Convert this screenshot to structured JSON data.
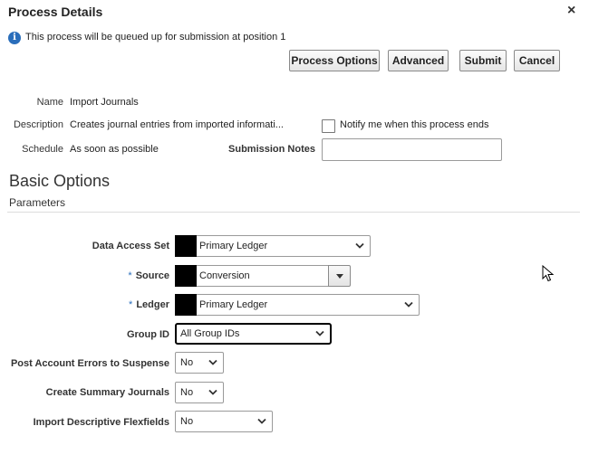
{
  "dialog": {
    "title": "Process Details",
    "close_glyph": "×",
    "info_message": "This process will be queued up for submission at position 1"
  },
  "toolbar": {
    "process_options": "Process Options",
    "advanced": "Advanced",
    "submit": "Submit",
    "cancel": "Cancel"
  },
  "details": {
    "name_label": "Name",
    "name_value": "Import Journals",
    "description_label": "Description",
    "description_value": "Creates journal entries from imported informati...",
    "schedule_label": "Schedule",
    "schedule_value": "As soon as possible",
    "notify_label": "Notify me when this process ends",
    "notify_checked": false,
    "submission_notes_label": "Submission Notes",
    "submission_notes_value": ""
  },
  "basic_options": {
    "heading": "Basic Options",
    "subheading": "Parameters"
  },
  "parameters": {
    "data_access_set": {
      "label": "Data Access Set",
      "value": "Primary Ledger"
    },
    "source": {
      "label": "Source",
      "value": "Conversion",
      "required_mark": "*"
    },
    "ledger": {
      "label": "Ledger",
      "value": "Primary Ledger",
      "required_mark": "*"
    },
    "group_id": {
      "label": "Group ID",
      "value": "All Group IDs"
    },
    "post_account_errors": {
      "label": "Post Account Errors to Suspense",
      "value": "No"
    },
    "create_summary_journals": {
      "label": "Create Summary Journals",
      "value": "No"
    },
    "import_descriptive_flexfields": {
      "label": "Import Descriptive Flexfields",
      "value": "No"
    }
  },
  "icons": {
    "info": "info-icon",
    "close": "close-icon",
    "chevron": "chevron-down-icon",
    "cursor": "mouse-pointer-icon"
  },
  "colors": {
    "info_icon": "#2a6ebb",
    "focus_border": "#000000",
    "button_border": "#8a8a8a"
  }
}
